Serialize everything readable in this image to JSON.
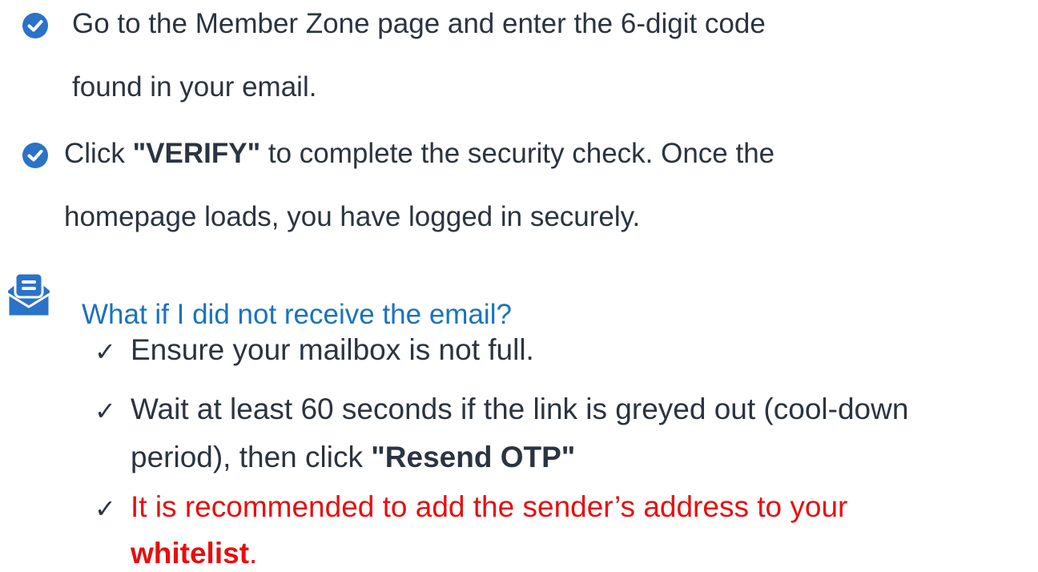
{
  "steps": [
    {
      "line1": "Go to the Member Zone page and enter the 6-digit code",
      "line2": "found in your email."
    },
    {
      "line1_pre": "Click ",
      "line1_bold": "\"VERIFY\"",
      "line1_post": " to complete the security check. Once the",
      "line2": "homepage loads, you have logged in securely."
    }
  ],
  "faq": {
    "icon": "envelope-message-icon",
    "title": "What if I did not receive the email?",
    "tips": [
      {
        "check": "✓",
        "line1": "Ensure your mailbox is not full."
      },
      {
        "check": "✓",
        "line1": "Wait at least 60 seconds if the link is greyed out (cool-down",
        "line2_pre": "period), then click ",
        "line2_bold": "\"Resend OTP\""
      },
      {
        "check": "✓",
        "line1": "It is recommended to add the sender’s address to your",
        "line2_bold": "whitelist",
        "line2_post": "."
      }
    ]
  },
  "colors": {
    "text": "#2b3440",
    "check_circle": "#2a73c8",
    "faq_blue": "#1a73be",
    "warning_red": "#e80e0e"
  }
}
